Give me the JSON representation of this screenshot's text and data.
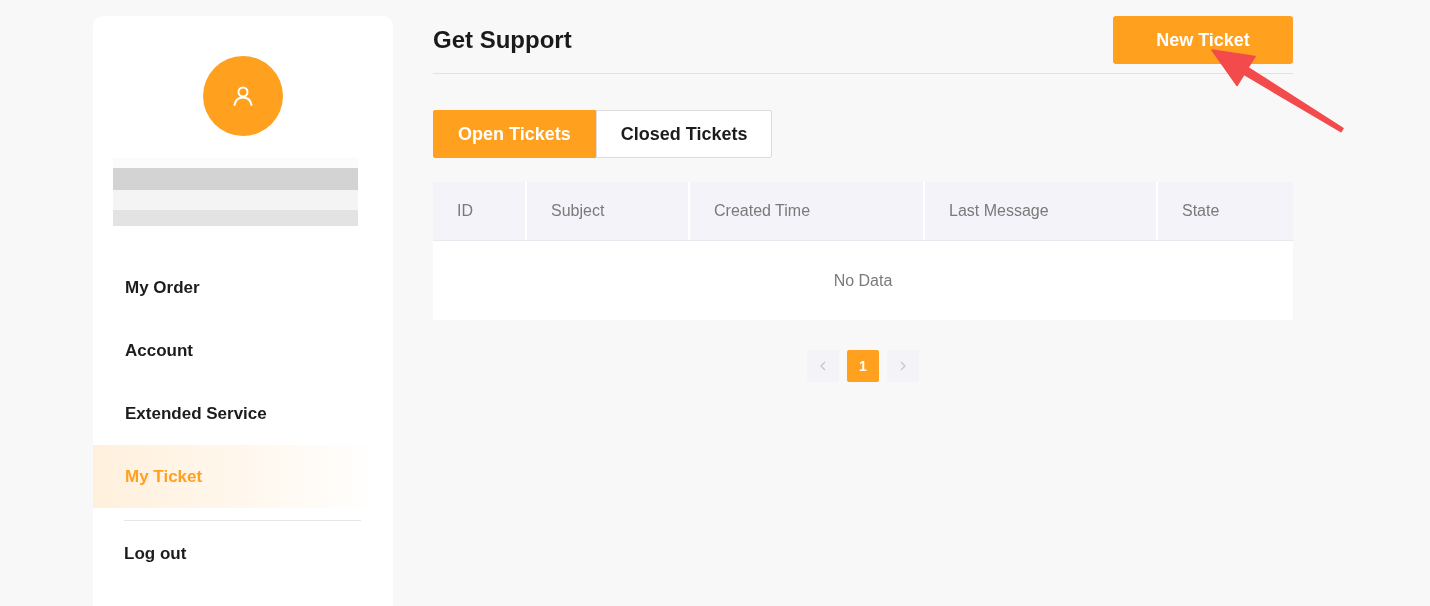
{
  "sidebar": {
    "menu": [
      {
        "label": "My Order",
        "selected": false
      },
      {
        "label": "Account",
        "selected": false
      },
      {
        "label": "Extended Service",
        "selected": false
      },
      {
        "label": "My Ticket",
        "selected": true
      }
    ],
    "logout": {
      "label": "Log out"
    }
  },
  "header": {
    "title": "Get Support",
    "new_ticket_button": "New Ticket"
  },
  "tabs": [
    {
      "label": "Open Tickets",
      "selected": true
    },
    {
      "label": "Closed Tickets",
      "selected": false
    }
  ],
  "table": {
    "columns": [
      "ID",
      "Subject",
      "Created Time",
      "Last Message",
      "State"
    ],
    "empty_text": "No Data"
  },
  "pagination": {
    "previous": {
      "disabled": true
    },
    "pages": [
      {
        "label": "1",
        "selected": true
      }
    ],
    "next": {
      "disabled": true
    }
  }
}
